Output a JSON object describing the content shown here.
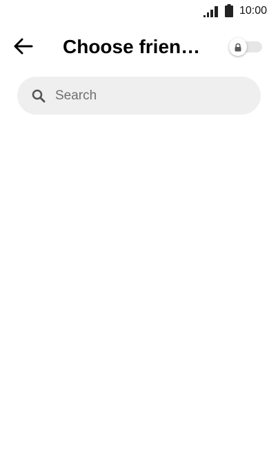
{
  "status_bar": {
    "time": "10:00",
    "icons": [
      "signal-icon",
      "battery-icon"
    ]
  },
  "header": {
    "back_icon": "back-arrow-icon",
    "title": "Choose frien…",
    "toggle": {
      "icon": "lock-icon",
      "state": "off"
    }
  },
  "search": {
    "icon": "search-icon",
    "placeholder": "Search",
    "value": ""
  },
  "colors": {
    "background": "#ffffff",
    "search_background": "#efefef",
    "toggle_track": "#e6e6e6",
    "placeholder_text": "#6f6f6f",
    "icon_gray": "#555555"
  }
}
